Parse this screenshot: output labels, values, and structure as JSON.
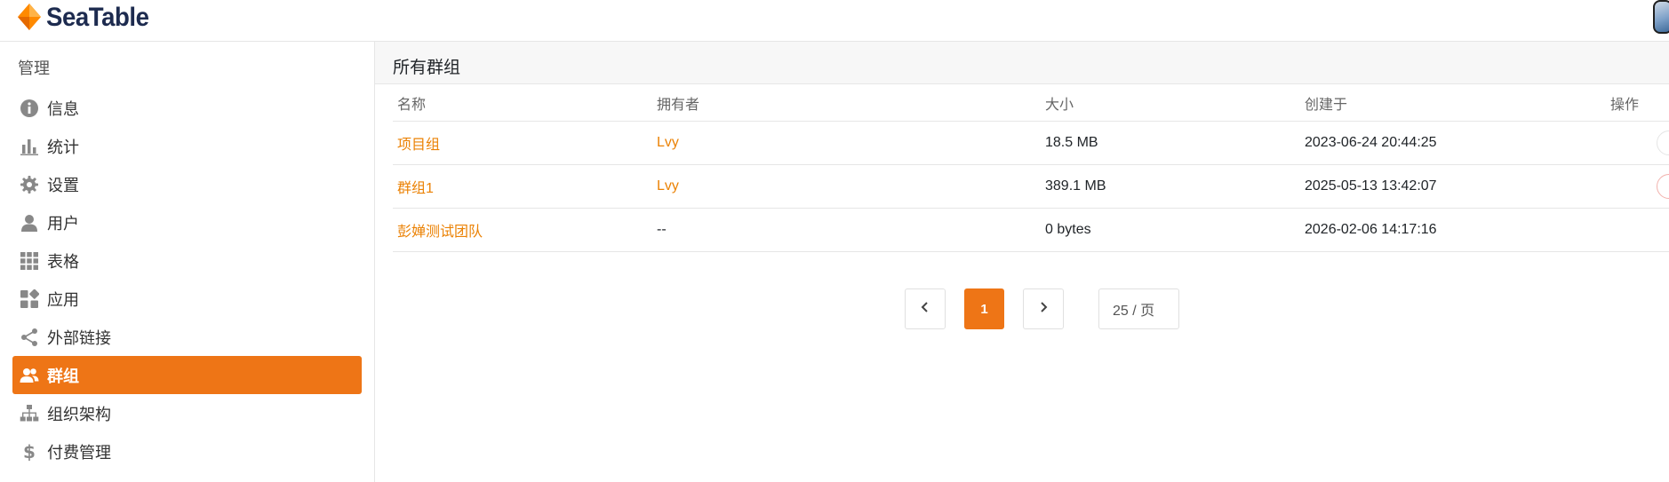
{
  "app": {
    "logo_text": "SeaTable"
  },
  "sidebar": {
    "heading": "管理",
    "items": [
      {
        "label": "信息",
        "icon": "info-icon"
      },
      {
        "label": "统计",
        "icon": "bar-chart-icon"
      },
      {
        "label": "设置",
        "icon": "gear-icon"
      },
      {
        "label": "用户",
        "icon": "user-icon"
      },
      {
        "label": "表格",
        "icon": "grid-icon"
      },
      {
        "label": "应用",
        "icon": "apps-icon"
      },
      {
        "label": "外部链接",
        "icon": "share-icon"
      },
      {
        "label": "群组",
        "icon": "group-icon",
        "active": true
      },
      {
        "label": "组织架构",
        "icon": "org-chart-icon"
      },
      {
        "label": "付费管理",
        "icon": "dollar-icon"
      }
    ]
  },
  "main": {
    "title": "所有群组",
    "table": {
      "headers": {
        "name": "名称",
        "owner": "拥有者",
        "size": "大小",
        "created": "创建于",
        "ops": "操作"
      },
      "rows": [
        {
          "name": "项目组",
          "owner": "Lvy",
          "size": "18.5 MB",
          "created": "2023-06-24 20:44:25"
        },
        {
          "name": "群组1",
          "owner": "Lvy",
          "size": "389.1 MB",
          "created": "2025-05-13 13:42:07"
        },
        {
          "name": "彭婵测试团队",
          "owner": "--",
          "size": "0 bytes",
          "created": "2026-02-06 14:17:16"
        }
      ]
    },
    "pagination": {
      "current_page": "1",
      "page_size": "25 / 页"
    }
  },
  "colors": {
    "accent": "#ee7516",
    "link": "#eb8205",
    "brand_dark": "#1d2b4f"
  }
}
